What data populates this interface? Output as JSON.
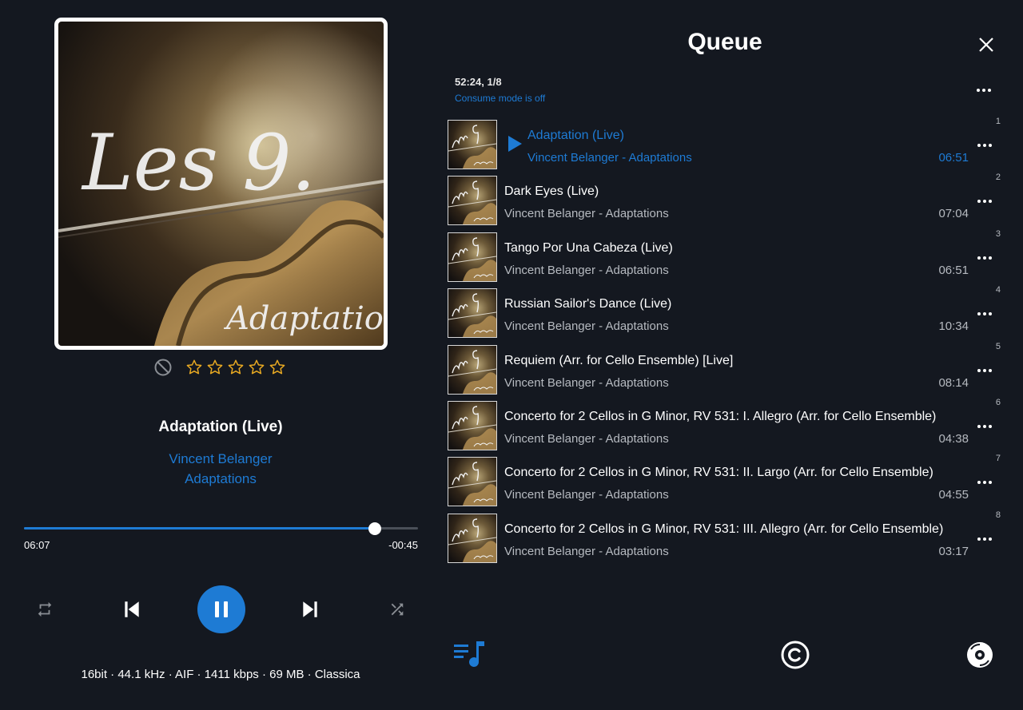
{
  "colors": {
    "accent": "#1e7bd4",
    "background": "#141820",
    "star": "#e8a922",
    "text": "#ffffff",
    "muted": "#b6bac0"
  },
  "now_playing": {
    "cover_text": {
      "line1": "Les 9.",
      "line2": "Adaptations"
    },
    "rating": {
      "value": 0,
      "max": 5
    },
    "title": "Adaptation (Live)",
    "artist": "Vincent Belanger",
    "album": "Adaptations",
    "elapsed": "06:07",
    "remaining": "-00:45",
    "progress_fraction": 0.89,
    "file_info": "16bit · 44.1 kHz · AIF · 1411 kbps · 69 MB · Classica"
  },
  "controls": {
    "repeat": "repeat-icon",
    "previous": "skip-previous-icon",
    "play_pause": "pause-icon",
    "next": "skip-next-icon",
    "shuffle": "shuffle-icon"
  },
  "queue": {
    "title": "Queue",
    "stats": "52:24, 1/8",
    "consume": "Consume mode is off",
    "tracks": [
      {
        "num": "1",
        "title": "Adaptation (Live)",
        "subtitle": "Vincent Belanger - Adaptations",
        "duration": "06:51",
        "playing": true
      },
      {
        "num": "2",
        "title": "Dark Eyes (Live)",
        "subtitle": "Vincent Belanger - Adaptations",
        "duration": "07:04",
        "playing": false
      },
      {
        "num": "3",
        "title": "Tango Por Una Cabeza (Live)",
        "subtitle": "Vincent Belanger - Adaptations",
        "duration": "06:51",
        "playing": false
      },
      {
        "num": "4",
        "title": "Russian Sailor's Dance (Live)",
        "subtitle": "Vincent Belanger - Adaptations",
        "duration": "10:34",
        "playing": false
      },
      {
        "num": "5",
        "title": "Requiem (Arr. for Cello Ensemble) [Live]",
        "subtitle": "Vincent Belanger - Adaptations",
        "duration": "08:14",
        "playing": false
      },
      {
        "num": "6",
        "title": "Concerto for 2 Cellos in G Minor, RV 531: I. Allegro (Arr. for Cello Ensemble)",
        "subtitle": "Vincent Belanger - Adaptations",
        "duration": "04:38",
        "playing": false
      },
      {
        "num": "7",
        "title": "Concerto for 2 Cellos in G Minor, RV 531: II. Largo (Arr. for Cello Ensemble)",
        "subtitle": "Vincent Belanger - Adaptations",
        "duration": "04:55",
        "playing": false
      },
      {
        "num": "8",
        "title": "Concerto for 2 Cellos in G Minor, RV 531: III. Allegro (Arr. for Cello Ensemble)",
        "subtitle": "Vincent Belanger - Adaptations",
        "duration": "03:17",
        "playing": false
      }
    ]
  },
  "bottom_nav": {
    "queue": "queue-music-icon",
    "copyright": "copyright-icon",
    "disc": "disc-icon"
  }
}
